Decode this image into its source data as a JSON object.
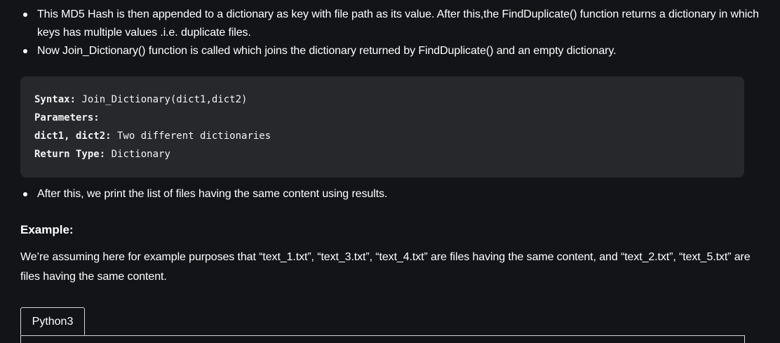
{
  "bullets": [
    "This MD5 Hash is then appended to a dictionary as key with file path as its value. After this,the FindDuplicate() function returns a dictionary in which keys has multiple values .i.e. duplicate files.",
    "Now Join_Dictionary() function is called which joins the dictionary returned by FindDuplicate() and an empty dictionary.",
    "After this, we print the list of files having the same content using results."
  ],
  "code_box": {
    "syntax_label": "Syntax:",
    "syntax_value": " Join_Dictionary(dict1,dict2)",
    "parameters_label": "Parameters:",
    "dicts_label": "dict1, dict2:",
    "dicts_value": " Two different dictionaries",
    "return_label": "Return Type:",
    "return_value": " Dictionary"
  },
  "example_heading": "Example:",
  "example_paragraph": "We’re assuming here for example purposes that “text_1.txt”, “text_3.txt”, “text_4.txt” are files having the same content, and “text_2.txt”, “text_5.txt” are files having the same content.",
  "code_tabs": [
    "Python3"
  ]
}
